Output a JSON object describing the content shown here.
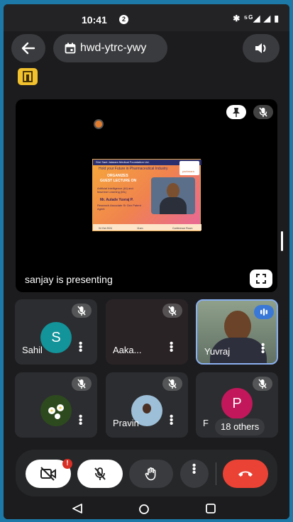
{
  "status_bar": {
    "time": "10:41",
    "notification_count": "2",
    "indicators": "✱ ⁵ᴳ◢ ◢ ▮"
  },
  "top_bar": {
    "meeting_code": "hwd-ytrc-ywy",
    "back_icon": "arrow-left-icon",
    "calendar_icon": "calendar-icon",
    "speaker_icon": "speaker-icon"
  },
  "room_icon": "breakout-room-icon",
  "presentation": {
    "status_text": "sanjay is presenting",
    "poster": {
      "header": "Shri Sant Jalaram Medical Foundation Ltd.",
      "subheader": "Hold your Future in Pharmaceutical Industry",
      "organizes": "ORGANIZES",
      "guest_lecture": "GUEST LECTURE ON",
      "topic": "Artificial Intelligence (AI) and Machine Learning (ML)",
      "speaker": "Mr. Aulade Yuvraj P.",
      "role": "Research Associate Sr Gen Patent Agent",
      "footer_date": "04 Oct 2024",
      "footer_time": "11am",
      "footer_venue": "Conference Room",
      "logo_text": "parkmara"
    }
  },
  "participants": [
    {
      "name": "Sahil",
      "initial": "S",
      "avatar_color": "#12949a",
      "muted": true
    },
    {
      "name": "Aaka...",
      "initial": "",
      "avatar_color": "",
      "muted": true
    },
    {
      "name": "Yuvraj",
      "initial": "",
      "avatar_color": "",
      "muted": false,
      "speaking": true
    },
    {
      "name": "",
      "initial": "",
      "avatar_color": "",
      "muted": true
    },
    {
      "name": "Pravin",
      "initial": "",
      "avatar_color": "",
      "muted": true
    },
    {
      "name": "F",
      "initial": "P",
      "avatar_color": "#c2185b",
      "muted": true
    }
  ],
  "others_label": "18 others",
  "controls": {
    "camera_alert": "!",
    "camera_icon": "camera-off-icon",
    "mic_icon": "mic-off-icon",
    "hand_icon": "raise-hand-icon",
    "more_icon": "more-vert-icon",
    "end_icon": "end-call-icon"
  },
  "colors": {
    "accent_blue": "#3a78d8",
    "end_call": "#ea4335",
    "room_icon": "#f2c12e"
  }
}
